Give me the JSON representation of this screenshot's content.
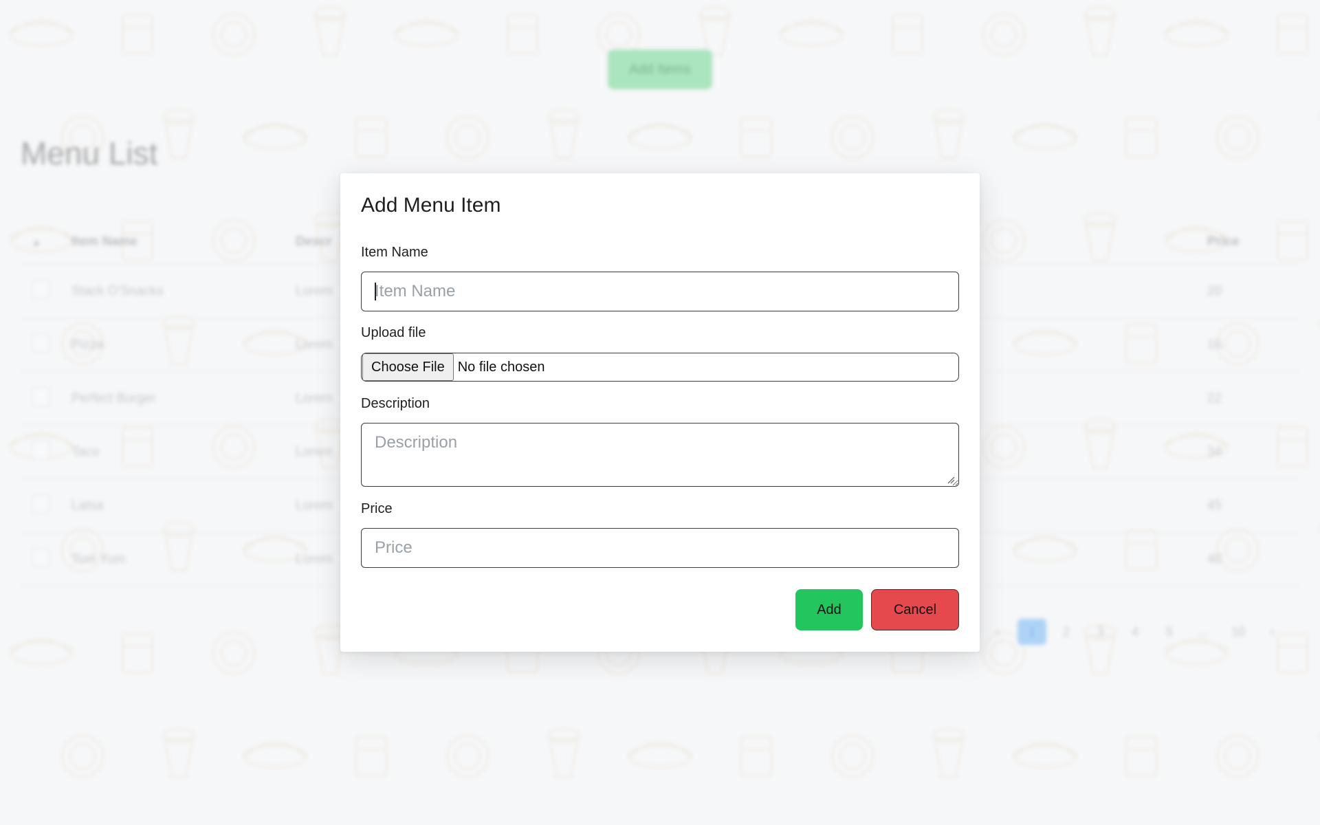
{
  "page": {
    "add_items_label": "Add Items",
    "title": "Menu List",
    "table": {
      "columns": [
        "Item Name",
        "Descr",
        "Price"
      ],
      "rows": [
        {
          "name": "Stack O'Snacks",
          "desc": "Lorem",
          "price": "20"
        },
        {
          "name": "Pizza",
          "desc": "Lorem",
          "price": "16"
        },
        {
          "name": "Perfect Burger",
          "desc": "Lorem",
          "price": "22"
        },
        {
          "name": "Taco",
          "desc": "Lorem",
          "price": "34"
        },
        {
          "name": "Latsa",
          "desc": "Lorem",
          "price": "45"
        },
        {
          "name": "Tom Yum",
          "desc": "Lorem",
          "price": "40"
        }
      ]
    },
    "pagination": {
      "prev": "‹",
      "pages": [
        "1",
        "2",
        "3",
        "4",
        "5",
        "...",
        "10"
      ],
      "next": "›",
      "current": "1"
    }
  },
  "modal": {
    "title": "Add Menu Item",
    "item_name": {
      "label": "Item Name",
      "placeholder": "Item Name",
      "value": ""
    },
    "upload": {
      "label": "Upload file",
      "button": "Choose File",
      "status": "No file chosen"
    },
    "description": {
      "label": "Description",
      "placeholder": "Description",
      "value": ""
    },
    "price": {
      "label": "Price",
      "placeholder": "Price",
      "value": ""
    },
    "add_label": "Add",
    "cancel_label": "Cancel"
  },
  "colors": {
    "background": "#f3f4f6",
    "add_green": "#22c55e",
    "cancel_red": "#e5484d",
    "pagination_active": "#93c5f5"
  },
  "icons": [
    "sort-up-icon",
    "checkbox-icon",
    "food-doodle-icon",
    "textarea-resize-icon"
  ]
}
